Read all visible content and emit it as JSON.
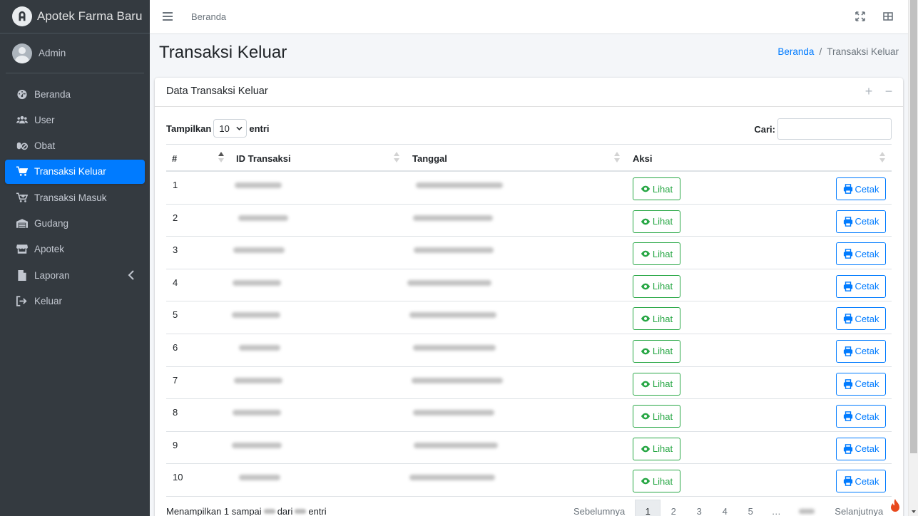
{
  "app": {
    "title": "Apotek Farma Baru",
    "user": "Admin"
  },
  "sidebar": {
    "items": [
      {
        "label": "Beranda",
        "icon": "dashboard-icon"
      },
      {
        "label": "User",
        "icon": "users-icon"
      },
      {
        "label": "Obat",
        "icon": "pills-icon"
      },
      {
        "label": "Transaksi Keluar",
        "icon": "cart-icon",
        "active": true
      },
      {
        "label": "Transaksi Masuk",
        "icon": "cart-plus-icon"
      },
      {
        "label": "Gudang",
        "icon": "warehouse-icon"
      },
      {
        "label": "Apotek",
        "icon": "store-icon"
      },
      {
        "label": "Laporan",
        "icon": "file-icon"
      },
      {
        "label": "Keluar",
        "icon": "sign-out-icon"
      }
    ]
  },
  "topbar": {
    "link": "Beranda"
  },
  "page": {
    "title": "Transaksi Keluar"
  },
  "breadcrumb": {
    "home": "Beranda",
    "separator": "/",
    "current": "Transaksi Keluar"
  },
  "card": {
    "title": "Data Transaksi Keluar",
    "collapse_symbol": "−",
    "add_symbol": "+"
  },
  "table_controls": {
    "show_label": "Tampilkan",
    "page_size": "10",
    "entries_label": "entri",
    "search_label": "Cari:",
    "search_value": ""
  },
  "table": {
    "headers": [
      "#",
      "ID Transaksi",
      "Tanggal",
      "Aksi"
    ],
    "rows": [
      {
        "no": "1",
        "view_label": "Lihat",
        "print_label": "Cetak"
      },
      {
        "no": "2",
        "view_label": "Lihat",
        "print_label": "Cetak"
      },
      {
        "no": "3",
        "view_label": "Lihat",
        "print_label": "Cetak"
      },
      {
        "no": "4",
        "view_label": "Lihat",
        "print_label": "Cetak"
      },
      {
        "no": "5",
        "view_label": "Lihat",
        "print_label": "Cetak"
      },
      {
        "no": "6",
        "view_label": "Lihat",
        "print_label": "Cetak"
      },
      {
        "no": "7",
        "view_label": "Lihat",
        "print_label": "Cetak"
      },
      {
        "no": "8",
        "view_label": "Lihat",
        "print_label": "Cetak"
      },
      {
        "no": "9",
        "view_label": "Lihat",
        "print_label": "Cetak"
      },
      {
        "no": "10",
        "view_label": "Lihat",
        "print_label": "Cetak"
      }
    ]
  },
  "footer": {
    "info_prefix": "Menampilkan 1 sampai",
    "info_middle": "dari",
    "info_suffix": "entri"
  },
  "pagination": {
    "prev": "Sebelumnya",
    "pages": [
      "1",
      "2",
      "3",
      "4",
      "5"
    ],
    "ellipsis": "…",
    "next": "Selanjutnya",
    "active_page": "1"
  },
  "colors": {
    "sidebar_bg": "#343a40",
    "active": "#007bff",
    "success": "#28a745"
  }
}
